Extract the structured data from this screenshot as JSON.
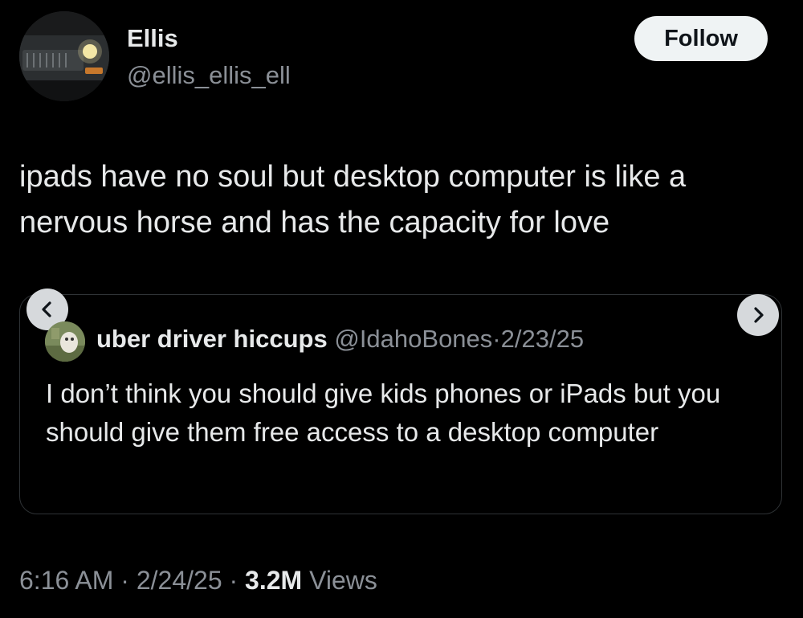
{
  "author": {
    "name": "Ellis",
    "handle": "@ellis_ellis_ell"
  },
  "follow_label": "Follow",
  "tweet_text": "ipads have no soul but desktop computer is like a nervous horse and has the capacity for love",
  "quoted": {
    "name": "uber driver hiccups",
    "handle": "@IdahoBones",
    "separator": "·",
    "date": "2/23/25",
    "text": "I don’t think you should give kids phones or iPads but you should give them free access to a desktop computer"
  },
  "footer": {
    "time": "6:16 AM",
    "separator": "·",
    "date": "2/24/25",
    "views_count": "3.2M",
    "views_label": "Views"
  },
  "icons": {
    "prev": "chevron-left-icon",
    "next": "chevron-right-icon"
  },
  "colors": {
    "background": "#000000",
    "text_primary": "#e7e9ea",
    "text_secondary": "#8b9097",
    "follow_bg": "#eff3f4",
    "border": "#2f3336"
  }
}
